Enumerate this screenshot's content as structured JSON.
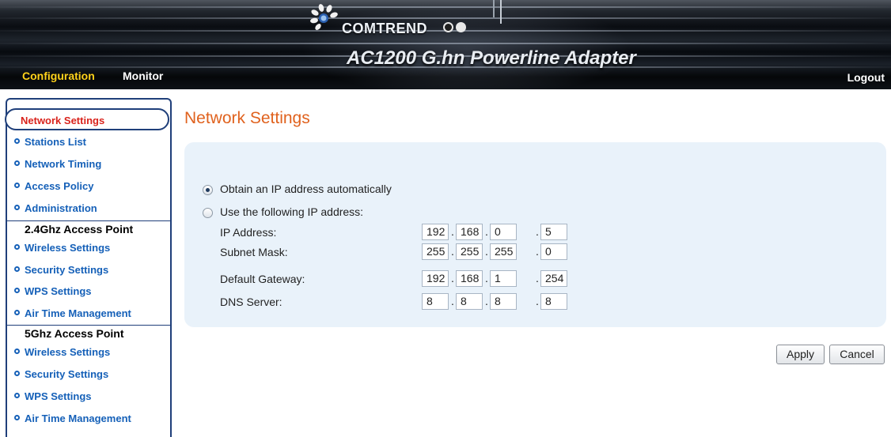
{
  "header": {
    "brand": "COMTREND",
    "product": "AC1200 G.hn Powerline Adapter",
    "nav": [
      "Configuration",
      "Monitor"
    ],
    "logout": "Logout",
    "colors": {
      "active_nav": "#ffd21a",
      "nav": "#ffffff"
    }
  },
  "sidebar": {
    "active": "Network Settings",
    "general": [
      "Stations List",
      "Network Timing",
      "Access Policy",
      "Administration"
    ],
    "sections": [
      {
        "heading": "2.4Ghz Access Point",
        "items": [
          "Wireless Settings",
          "Security Settings",
          "WPS Settings",
          "Air Time Management"
        ]
      },
      {
        "heading": "5Ghz Access Point",
        "items": [
          "Wireless Settings",
          "Security Settings",
          "WPS Settings",
          "Air Time Management"
        ]
      }
    ],
    "colors": {
      "active": "#d9231c",
      "item": "#1560b8"
    }
  },
  "main": {
    "title": "Network Settings",
    "options": [
      {
        "label": "Obtain an IP address automatically",
        "selected": true
      },
      {
        "label": "Use the following IP address:",
        "selected": false
      }
    ],
    "fields": [
      {
        "label": "IP Address:",
        "octets": [
          "192",
          "168",
          "0",
          "5"
        ]
      },
      {
        "label": "Subnet Mask:",
        "octets": [
          "255",
          "255",
          "255",
          "0"
        ]
      },
      {
        "label": "Default Gateway:",
        "octets": [
          "192",
          "168",
          "1",
          "254"
        ]
      },
      {
        "label": "DNS Server:",
        "octets": [
          "8",
          "8",
          "8",
          "8"
        ]
      }
    ],
    "separator": ".",
    "buttons": {
      "apply": "Apply",
      "cancel": "Cancel"
    },
    "colors": {
      "title": "#e0621e",
      "panel": "#e9f2fa"
    }
  }
}
